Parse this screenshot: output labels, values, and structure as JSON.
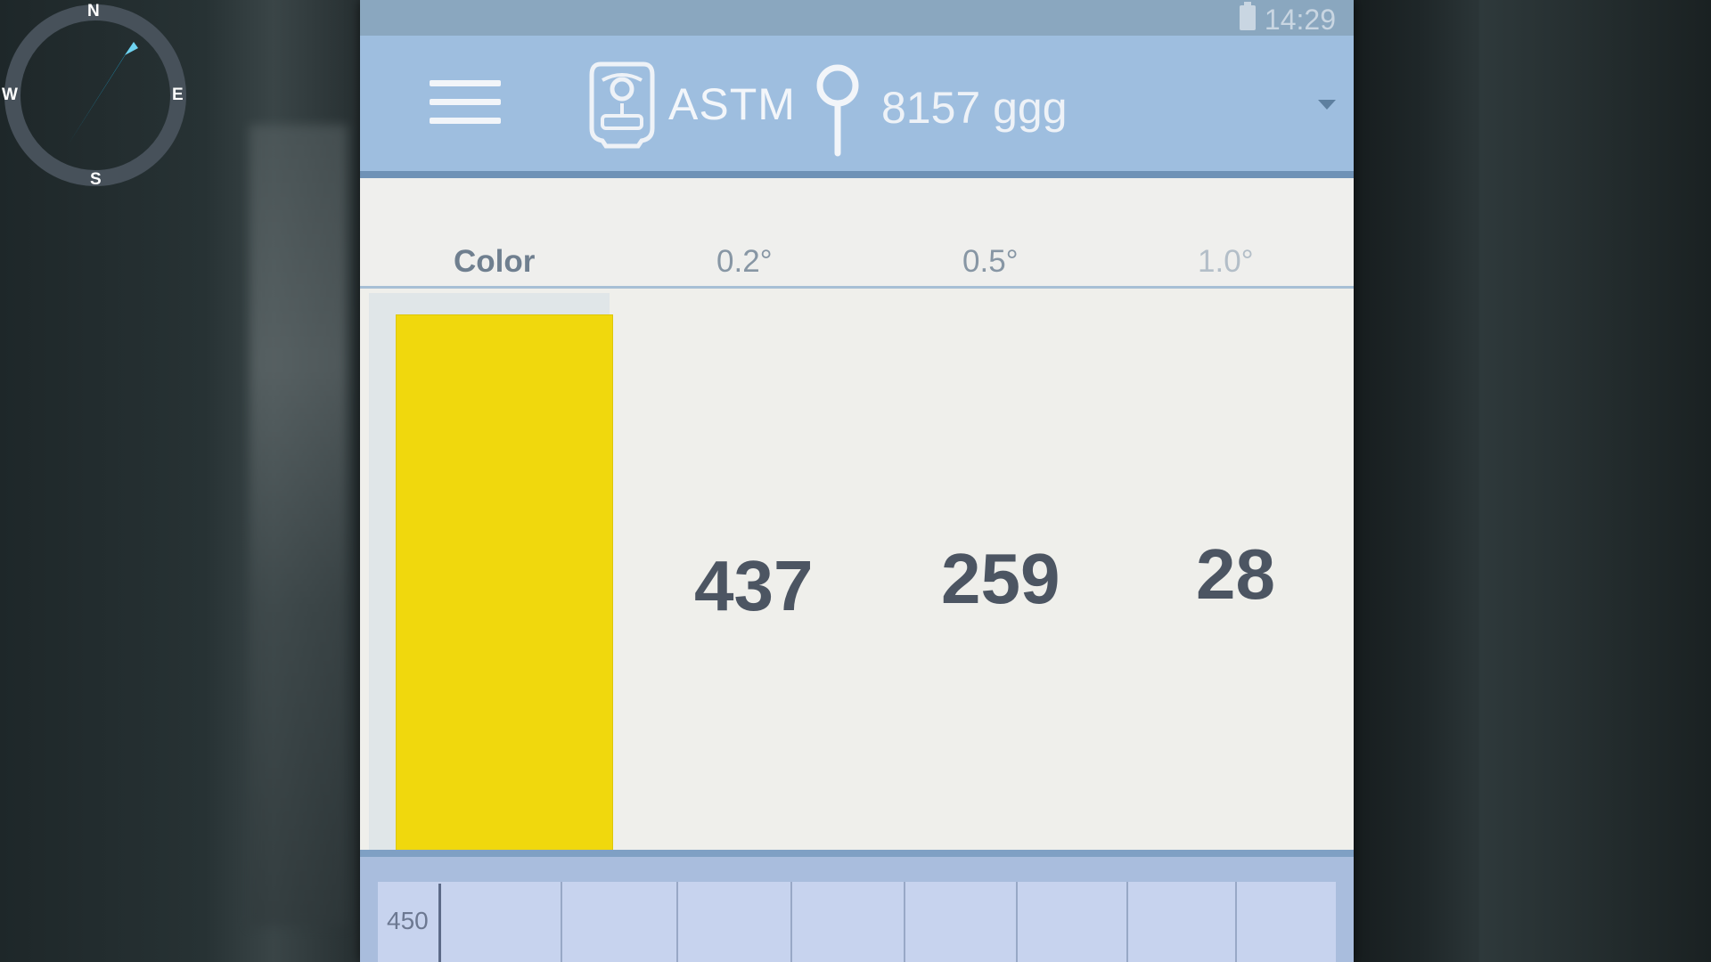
{
  "compass": {
    "north": "N",
    "south": "S",
    "east": "E",
    "west": "W",
    "icon": "compass-icon"
  },
  "status_bar": {
    "time": "14:29",
    "battery_icon": "battery-icon"
  },
  "app_bar": {
    "menu_icon": "hamburger-menu-icon",
    "device_icon": "device-icon",
    "mode_label": "ASTM",
    "pin_icon": "location-pin-icon",
    "location_name": "8157 ggg",
    "dropdown_icon": "dropdown-arrow-icon"
  },
  "table": {
    "headers": [
      "Color",
      "0.2°",
      "0.5°",
      "1.0°"
    ],
    "row": {
      "color_hex": "#f0d80d",
      "values": [
        "437",
        "259",
        "28"
      ]
    }
  },
  "graph": {
    "y_axis_label": "450"
  },
  "colors": {
    "app_bar": "#9ebedf",
    "swatch": "#f0d80d",
    "value_text": "#4c5562"
  }
}
